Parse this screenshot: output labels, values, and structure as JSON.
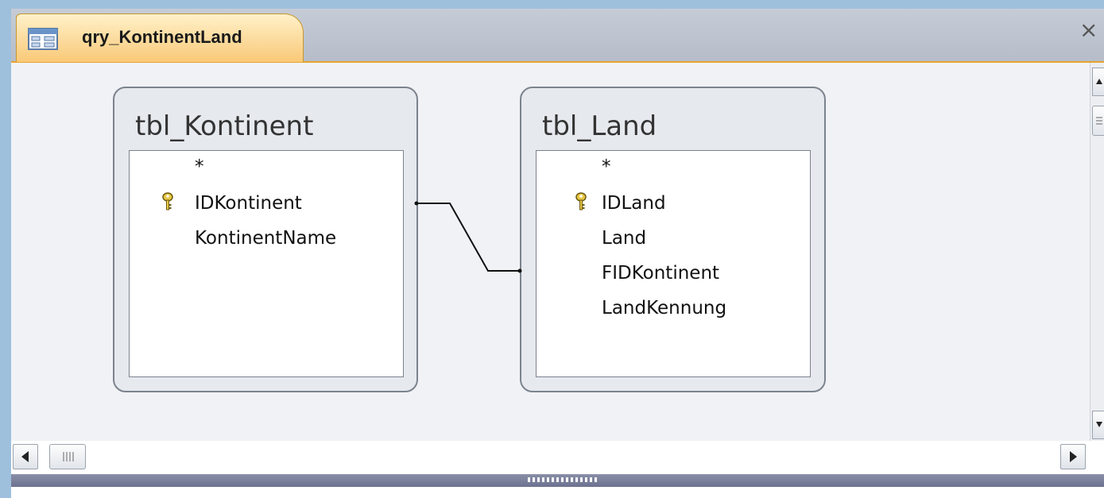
{
  "window": {
    "tab_title": "qry_KontinentLand",
    "tab_icon": "query-icon",
    "close_label": "×"
  },
  "tables": [
    {
      "name": "tbl_Kontinent",
      "fields": [
        {
          "label": "*",
          "primary_key": false
        },
        {
          "label": "IDKontinent",
          "primary_key": true
        },
        {
          "label": "KontinentName",
          "primary_key": false
        }
      ]
    },
    {
      "name": "tbl_Land",
      "fields": [
        {
          "label": "*",
          "primary_key": false
        },
        {
          "label": "IDLand",
          "primary_key": true
        },
        {
          "label": "Land",
          "primary_key": false
        },
        {
          "label": "FIDKontinent",
          "primary_key": false
        },
        {
          "label": "LandKennung",
          "primary_key": false
        }
      ]
    }
  ],
  "relationship": {
    "from": "tbl_Kontinent.IDKontinent",
    "to": "tbl_Land.FIDKontinent"
  },
  "colors": {
    "tab_active": "#f9c978",
    "canvas": "#f0f2f6",
    "splitter": "#6c7190"
  }
}
